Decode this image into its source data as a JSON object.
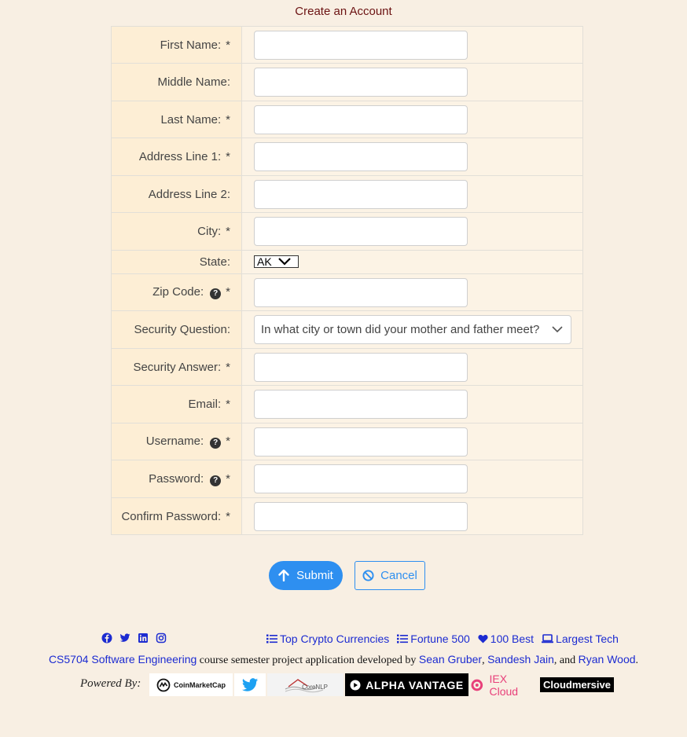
{
  "page": {
    "title": "Create an Account"
  },
  "form": {
    "rows": [
      {
        "label": "First Name:",
        "required": "*",
        "value": ""
      },
      {
        "label": "Middle Name:",
        "value": ""
      },
      {
        "label": "Last Name:",
        "required": "*",
        "value": ""
      },
      {
        "label": "Address Line 1:",
        "required": "*",
        "value": ""
      },
      {
        "label": "Address Line 2:",
        "value": ""
      },
      {
        "label": "City:",
        "required": "*",
        "value": ""
      },
      {
        "label": "State:",
        "selected": "AK"
      },
      {
        "label": "Zip Code:",
        "help": "?",
        "required": "*",
        "value": ""
      },
      {
        "label": "Security Question:",
        "selected": "In what city or town did your mother and father meet?"
      },
      {
        "label": "Security Answer:",
        "required": "*",
        "value": ""
      },
      {
        "label": "Email:",
        "required": "*",
        "value": ""
      },
      {
        "label": "Username:",
        "help": "?",
        "required": "*",
        "value": ""
      },
      {
        "label": "Password:",
        "help": "?",
        "required": "*",
        "value": ""
      },
      {
        "label": "Confirm Password:",
        "required": "*",
        "value": ""
      }
    ]
  },
  "buttons": {
    "submit": "Submit",
    "cancel": "Cancel"
  },
  "footer": {
    "social_icons": [
      "facebook-icon",
      "twitter-icon",
      "linkedin-icon",
      "instagram-icon"
    ],
    "links": [
      {
        "label": "Top Crypto Currencies",
        "icon": "list-icon"
      },
      {
        "label": "Fortune 500",
        "icon": "list-icon"
      },
      {
        "label": "100 Best",
        "icon": "heart-icon"
      },
      {
        "label": "Largest Tech",
        "icon": "laptop-icon"
      }
    ],
    "credits": {
      "course": "CS5704 Software Engineering",
      "text1": " course semester project application developed by ",
      "author1": "Sean Gruber",
      "sep1": ", ",
      "author2": "Sandesh Jain",
      "sep2": ", and ",
      "author3": "Ryan Wood",
      "end": "."
    },
    "powered_by": "Powered By:",
    "logos": [
      "CoinMarketCap",
      "twitter",
      "CoreNLP",
      "ALPHA VANTAGE",
      "IEX Cloud",
      "Cloudmersive"
    ]
  },
  "colors": {
    "accent": "#2e8ff0",
    "link": "#1c2bd1",
    "title": "#6b1212",
    "background": "#f8efe3"
  }
}
